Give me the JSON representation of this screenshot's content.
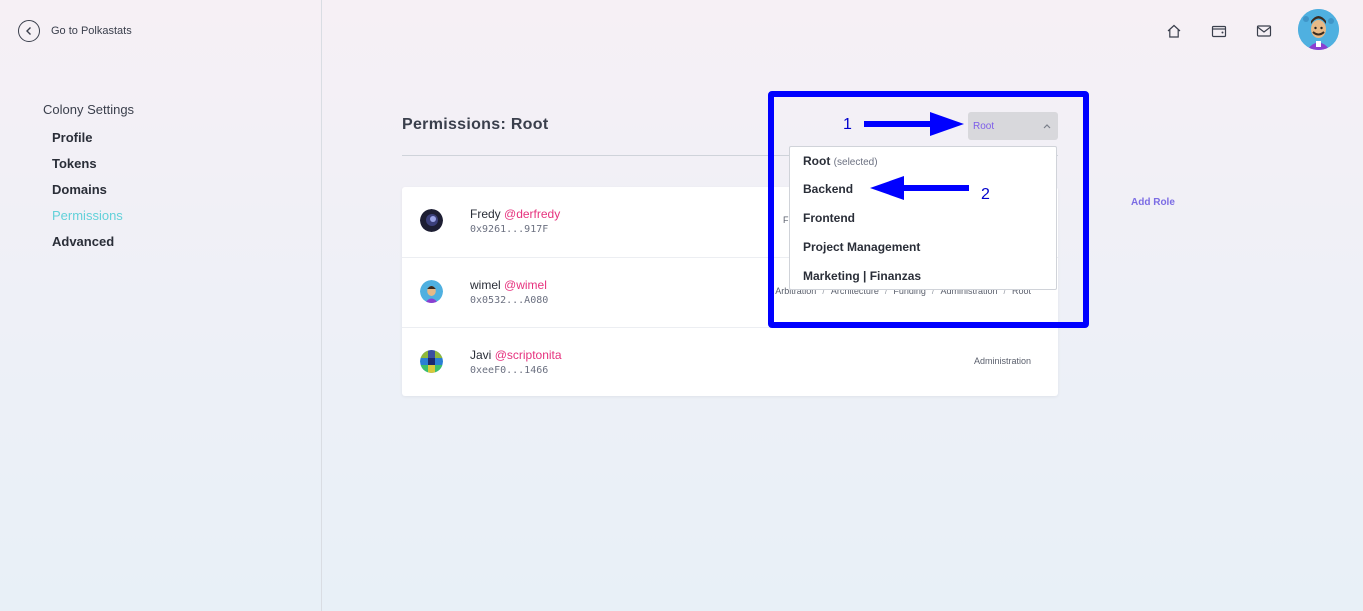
{
  "sidebar": {
    "back_label": "Go to Polkastats",
    "section_title": "Colony Settings",
    "items": [
      {
        "label": "Profile",
        "active": false
      },
      {
        "label": "Tokens",
        "active": false
      },
      {
        "label": "Domains",
        "active": false
      },
      {
        "label": "Permissions",
        "active": true
      },
      {
        "label": "Advanced",
        "active": false
      }
    ]
  },
  "header": {
    "icons": [
      "home-icon",
      "wallet-icon",
      "mail-icon"
    ],
    "avatar": "user-avatar"
  },
  "main": {
    "title": "Permissions: Root",
    "domain_select": {
      "value": "Root"
    },
    "add_role_label": "Add Role",
    "members": [
      {
        "name": "Fredy",
        "handle": "@derfredy",
        "address": "0x9261...917F",
        "roles": [
          "F"
        ]
      },
      {
        "name": "wimel",
        "handle": "@wimel",
        "address": "0x0532...A080",
        "roles": [
          "Arbitration",
          "Architecture",
          "Funding",
          "Administration",
          "Root"
        ]
      },
      {
        "name": "Javi",
        "handle": "@scriptonita",
        "address": "0xeeF0...1466",
        "roles": [
          "Administration"
        ]
      }
    ]
  },
  "dropdown": {
    "items": [
      {
        "label": "Root",
        "suffix": "(selected)"
      },
      {
        "label": "Backend",
        "suffix": ""
      },
      {
        "label": "Frontend",
        "suffix": ""
      },
      {
        "label": "Project Management",
        "suffix": ""
      },
      {
        "label": "Marketing | Finanzas",
        "suffix": ""
      }
    ]
  },
  "annotations": {
    "color": "#0000ff",
    "labels": [
      "1",
      "2"
    ]
  }
}
